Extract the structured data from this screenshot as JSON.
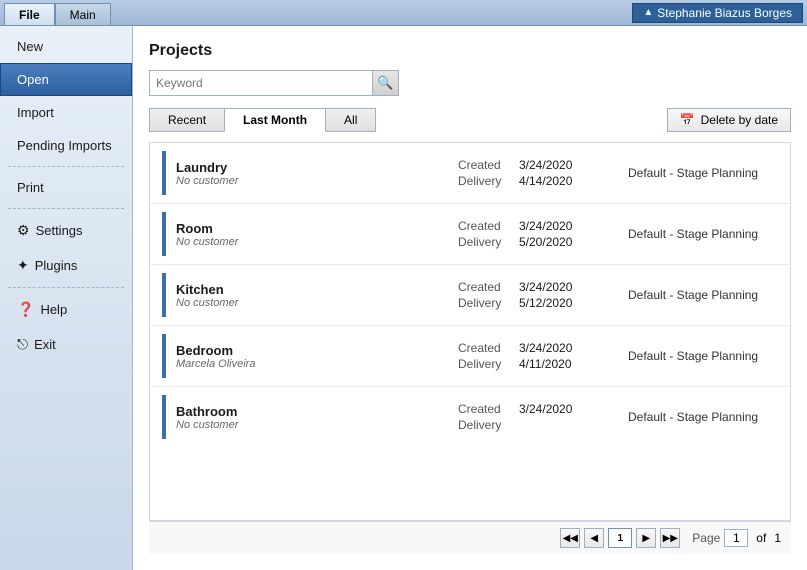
{
  "titleBar": {
    "tabs": [
      {
        "label": "File",
        "active": false
      },
      {
        "label": "Main",
        "active": true
      }
    ],
    "user": "Stephanie Biazus Borges"
  },
  "sidebar": {
    "items": [
      {
        "label": "New",
        "icon": "",
        "active": false,
        "id": "new"
      },
      {
        "label": "Open",
        "icon": "",
        "active": true,
        "id": "open"
      },
      {
        "label": "Import",
        "icon": "",
        "active": false,
        "id": "import"
      },
      {
        "label": "Pending Imports",
        "icon": "",
        "active": false,
        "id": "pending-imports"
      },
      {
        "label": "Print",
        "icon": "",
        "active": false,
        "id": "print"
      },
      {
        "label": "Settings",
        "icon": "⚙",
        "active": false,
        "id": "settings"
      },
      {
        "label": "Plugins",
        "icon": "✦",
        "active": false,
        "id": "plugins"
      },
      {
        "label": "Help",
        "icon": "?",
        "active": false,
        "id": "help"
      },
      {
        "label": "Exit",
        "icon": "⎋",
        "active": false,
        "id": "exit"
      }
    ]
  },
  "content": {
    "title": "Projects",
    "search": {
      "placeholder": "Keyword",
      "value": ""
    },
    "tabs": [
      {
        "label": "Recent",
        "active": false
      },
      {
        "label": "Last Month",
        "active": true
      },
      {
        "label": "All",
        "active": false
      }
    ],
    "deleteButton": "Delete by date",
    "projects": [
      {
        "name": "Laundry",
        "customer": "No customer",
        "created": "3/24/2020",
        "delivery": "4/14/2020",
        "stage": "Default - Stage Planning"
      },
      {
        "name": "Room",
        "customer": "No customer",
        "created": "3/24/2020",
        "delivery": "5/20/2020",
        "stage": "Default - Stage Planning"
      },
      {
        "name": "Kitchen",
        "customer": "No customer",
        "created": "3/24/2020",
        "delivery": "5/12/2020",
        "stage": "Default - Stage Planning"
      },
      {
        "name": "Bedroom",
        "customer": "Marcela Oliveira",
        "created": "3/24/2020",
        "delivery": "4/11/2020",
        "stage": "Default - Stage Planning"
      },
      {
        "name": "Bathroom",
        "customer": "No customer",
        "created": "3/24/2020",
        "delivery": "",
        "stage": "Default - Stage Planning"
      }
    ],
    "pagination": {
      "currentPage": "1",
      "totalPages": "1",
      "pageLabel": "Page",
      "ofLabel": "of"
    }
  },
  "labels": {
    "created": "Created",
    "delivery": "Delivery",
    "calendarIcon": "📅",
    "searchIcon": "🔍",
    "helpIcon": "❓",
    "exitIcon": "🚪",
    "firstPage": "◀◀",
    "prevPage": "◀",
    "nextPage": "▶",
    "lastPage": "▶▶",
    "settingsIcon": "⚙",
    "pluginsIcon": "✦"
  }
}
